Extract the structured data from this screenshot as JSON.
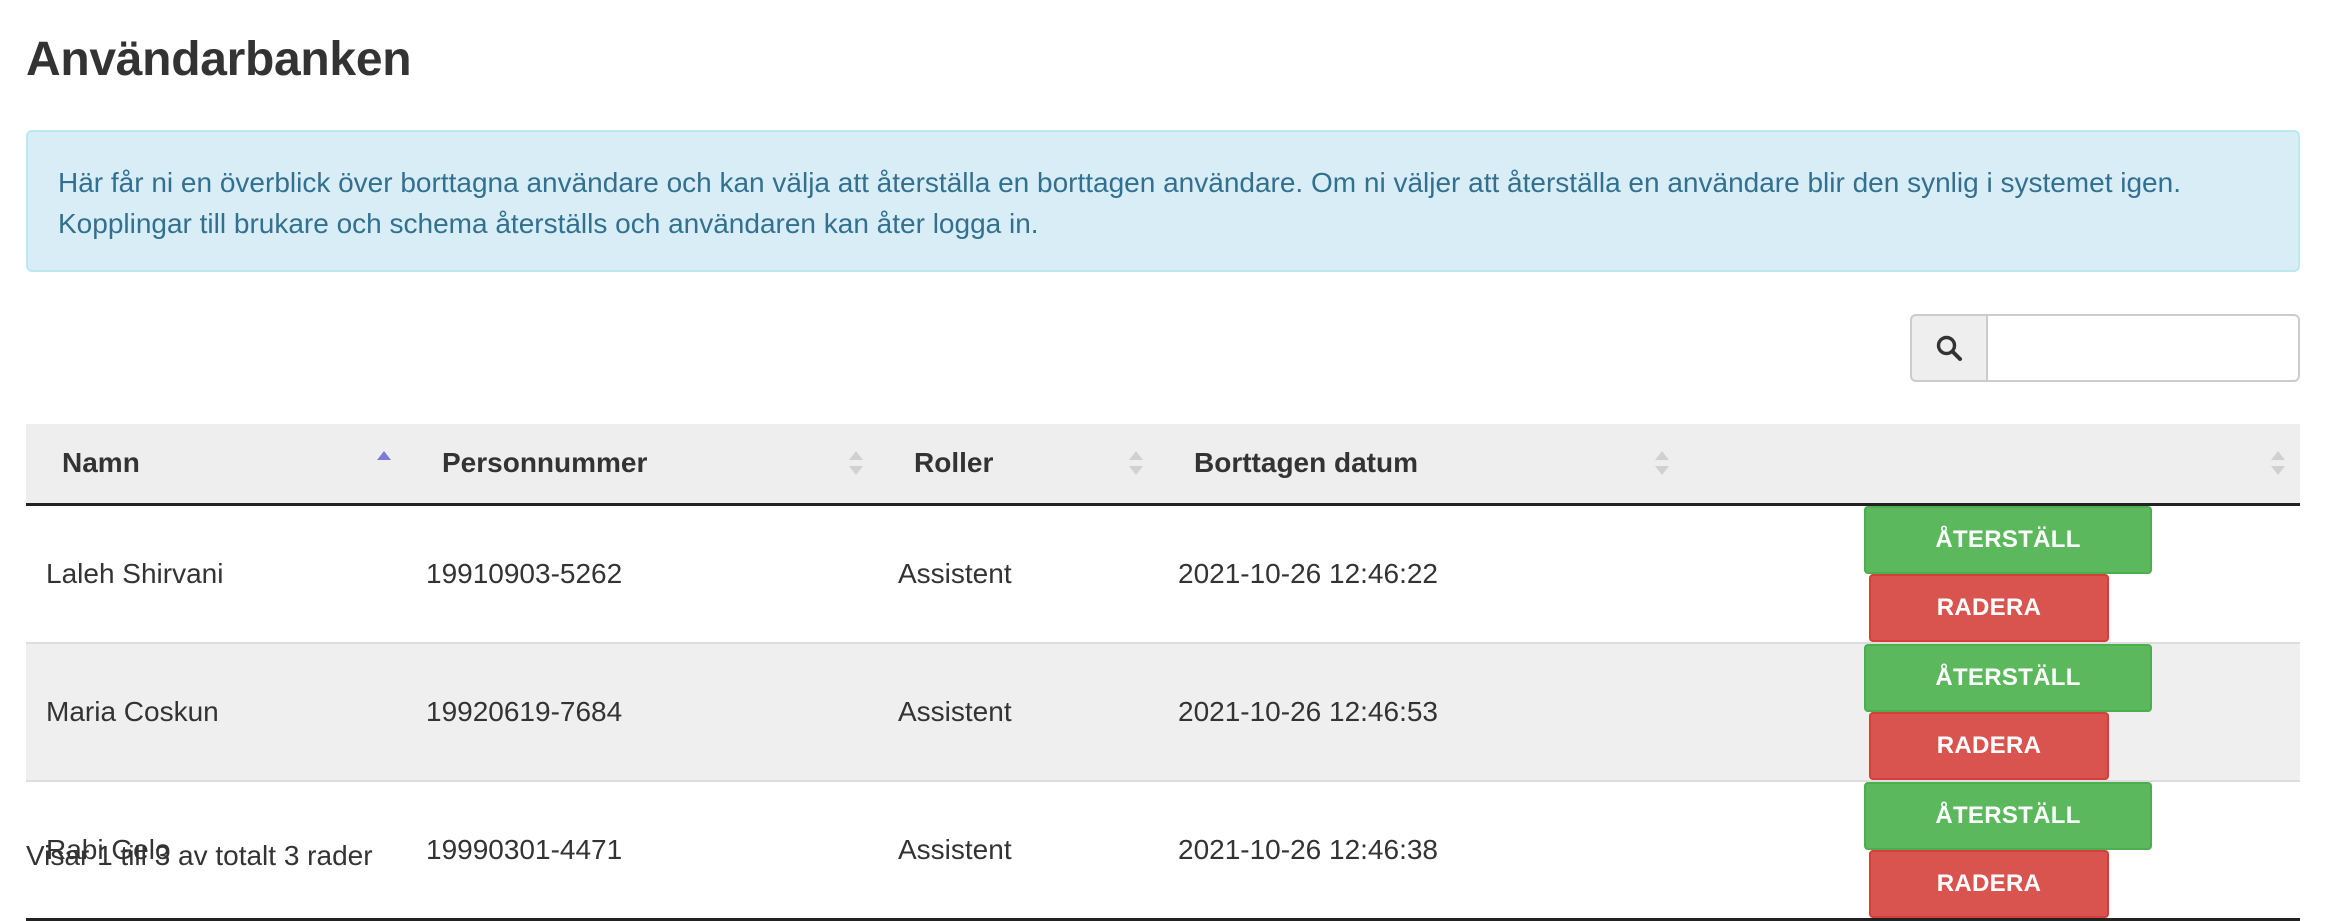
{
  "page": {
    "title": "Användarbanken"
  },
  "info": {
    "line1": "Här får ni en överblick över borttagna användare och kan välja att återställa en borttagen användare. Om ni väljer att återställa en användare blir den synlig i systemet igen.",
    "line2": "Kopplingar till brukare och schema återställs och användaren kan åter logga in."
  },
  "search": {
    "icon": "search-icon",
    "value": "",
    "placeholder": ""
  },
  "table": {
    "columns": [
      {
        "label": "Namn",
        "sort": "ascending"
      },
      {
        "label": "Personnummer",
        "sort": "none"
      },
      {
        "label": "Roller",
        "sort": "none"
      },
      {
        "label": "Borttagen datum",
        "sort": "none"
      },
      {
        "label": "",
        "sort": "none"
      }
    ],
    "rows": [
      {
        "name": "Laleh Shirvani",
        "personnummer": "19910903-5262",
        "role": "Assistent",
        "deleted": "2021-10-26 12:46:22",
        "restore_label": "ÅTERSTÄLL",
        "delete_label": "RADERA"
      },
      {
        "name": "Maria Coskun",
        "personnummer": "19920619-7684",
        "role": "Assistent",
        "deleted": "2021-10-26 12:46:53",
        "restore_label": "ÅTERSTÄLL",
        "delete_label": "RADERA"
      },
      {
        "name": "Rabi Gelo",
        "personnummer": "19990301-4471",
        "role": "Assistent",
        "deleted": "2021-10-26 12:46:38",
        "restore_label": "ÅTERSTÄLL",
        "delete_label": "RADERA"
      }
    ]
  },
  "footer": {
    "summary": "Visar 1 till 3 av totalt 3 rader"
  },
  "colors": {
    "info_bg": "#d9edf7",
    "info_text": "#31708f",
    "success": "#5cb85c",
    "danger": "#d9534f",
    "sort_active": "#7b7bd9"
  }
}
